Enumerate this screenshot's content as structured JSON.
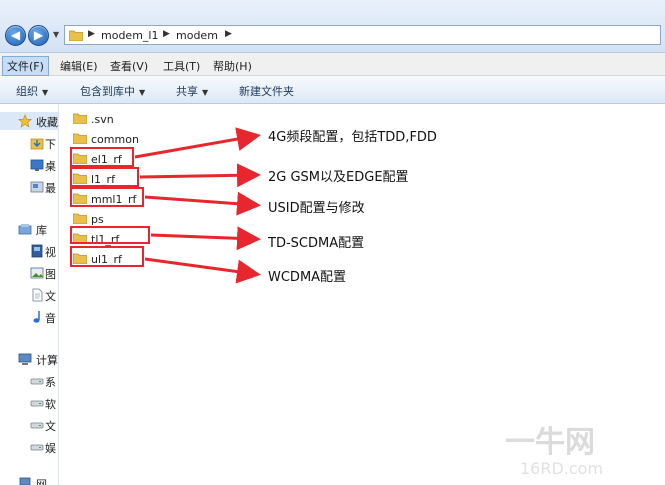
{
  "address_bar": {
    "breadcrumbs": [
      "modem_l1",
      "modem"
    ]
  },
  "menu": [
    "文件(F)",
    "编辑(E)",
    "查看(V)",
    "工具(T)",
    "帮助(H)"
  ],
  "toolbar": {
    "organize": "组织",
    "include_library": "包含到库中",
    "share": "共享",
    "new_folder": "新建文件夹"
  },
  "nav": {
    "favorites": "收藏",
    "fav_items": [
      "下",
      "桌",
      "最"
    ],
    "libraries": "库",
    "lib_items": [
      "视",
      "图",
      "文",
      "音"
    ],
    "computer": "计算",
    "computer_items": [
      "系",
      "软",
      "文",
      "娱"
    ],
    "network": "网"
  },
  "files": [
    ".svn",
    "common",
    "el1_rf",
    "l1_rf",
    "mml1_rf",
    "ps",
    "tl1_rf",
    "ul1_rf"
  ],
  "annotations": [
    "4G频段配置，包括TDD,FDD",
    "2G GSM以及EDGE配置",
    "USID配置与修改",
    "TD-SCDMA配置",
    "WCDMA配置"
  ],
  "colors": {
    "annotation": "#e8262d",
    "folder": "#e9c04a"
  },
  "watermark": "一牛网 16RD.com"
}
